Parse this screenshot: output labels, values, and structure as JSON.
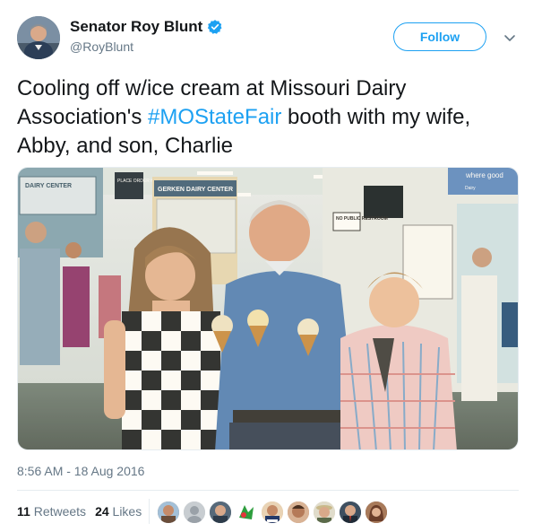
{
  "author": {
    "display_name": "Senator Roy Blunt",
    "handle": "@RoyBlunt",
    "verified": true,
    "verified_icon": "verified-badge-icon",
    "avatar": "author-avatar"
  },
  "actions": {
    "follow_label": "Follow",
    "more_icon": "chevron-down-icon"
  },
  "tweet": {
    "text_before": "Cooling off w/ice cream at Missouri Dairy Association's ",
    "hashtag": "#MOStateFair",
    "text_after": " booth with my wife, Abby, and son, Charlie"
  },
  "photo": {
    "signs": {
      "dairy_center_left": "DAIRY CENTER",
      "place_order": "PLACE ORDER HERE",
      "gerken": "GERKEN DAIRY CENTER",
      "no_public": "NO PUBLIC RESTROOM",
      "where_good": "where good",
      "dairy_small": "Dairy"
    }
  },
  "meta": {
    "timestamp": "8:56 AM - 18 Aug 2016"
  },
  "stats": {
    "retweets_count": "11",
    "retweets_label": "Retweets",
    "likes_count": "24",
    "likes_label": "Likes"
  },
  "colors": {
    "accent": "#1da1f2",
    "text": "#14171a",
    "muted": "#657786",
    "border": "#e6ecf0"
  }
}
